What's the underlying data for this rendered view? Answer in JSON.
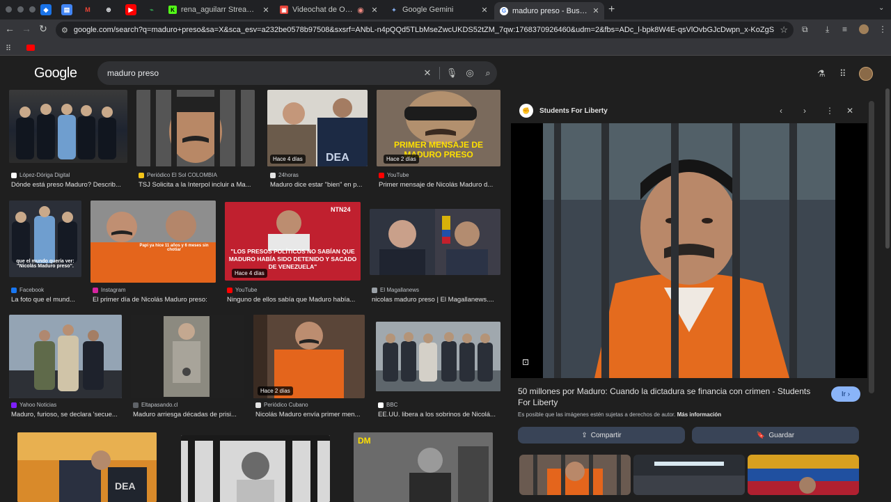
{
  "browser": {
    "pinned_tabs": [
      "drive-icon",
      "docs-icon",
      "gmail-icon",
      "chatgpt-icon",
      "youtube-icon",
      "meet-icon"
    ],
    "tabs": [
      {
        "title": "rena_aguilarr Stream - Watch",
        "favicon": "kick-icon",
        "favcolor": "#53fc18",
        "favchar": "K"
      },
      {
        "title": "Videochat de OmeTV: una",
        "favicon": "ometv-icon",
        "favcolor": "#e8443a",
        "favchar": "▣"
      },
      {
        "title": "Google Gemini",
        "favicon": "gemini-icon",
        "favcolor": "#4f86f7",
        "favchar": "✦"
      },
      {
        "title": "maduro preso - Buscar con G",
        "favicon": "google-icon",
        "favcolor": "#ffffff",
        "favchar": "G"
      }
    ],
    "url": "google.com/search?q=maduro+preso&sa=X&sca_esv=a232be0578b97508&sxsrf=ANbL-n4pQQd5TLbMseZwcUKDS52tZM_7qw:1768370926460&udm=2&fbs=ADc_l-bpk8W4E-qsVlOvbGJcDwpn_x-KoZgS_dIzvUJcCpPvNisF..."
  },
  "search": {
    "logo": "Google",
    "query": "maduro preso"
  },
  "results": [
    {
      "source": "López-Dóriga Digital",
      "title": "Dónde está preso Maduro? Describ...",
      "badge": "",
      "overlay": ""
    },
    {
      "source": "Periódico El Sol COLOMBIA",
      "title": "TSJ Solicita a la Interpol incluir a Ma...",
      "badge": "",
      "overlay": ""
    },
    {
      "source": "24horas",
      "title": "Maduro dice estar \"bien\" en p...",
      "badge": "Hace 4 días",
      "overlay": ""
    },
    {
      "source": "YouTube",
      "title": "Primer mensaje de Nicolás Maduro d...",
      "badge": "Hace 2 días",
      "overlay": "PRIMER MENSAJE DE MADURO PRESO"
    },
    {
      "source": "Facebook",
      "title": "La foto que el mund...",
      "badge": "",
      "overlay": "que el mundo quería ver: \"Nicolás Maduro preso\"."
    },
    {
      "source": "Instagram",
      "title": "El primer día de Nicolás Maduro preso:",
      "badge": "",
      "overlay": "Papi ya hice 11 años y 6 meses sin chotiar"
    },
    {
      "source": "YouTube",
      "title": "Ninguno de ellos sabía que Maduro había...",
      "badge": "Hace 4 días",
      "overlay": "\"LOS PRESOS POLÍTICOS NO SABÍAN QUE MADURO HABÍA SIDO DETENIDO Y SACADO DE VENEZUELA\""
    },
    {
      "source": "El Magallanews",
      "title": "nicolas maduro preso | El Magallanews....",
      "badge": "",
      "overlay": ""
    },
    {
      "source": "Yahoo Noticias",
      "title": "Maduro, furioso, se declara 'secue...",
      "badge": "",
      "overlay": ""
    },
    {
      "source": "Eltapasando.cl",
      "title": "Maduro arriesga décadas de prisi...",
      "badge": "",
      "overlay": ""
    },
    {
      "source": "Periódico Cubano",
      "title": "Nicolás Maduro envía primer men...",
      "badge": "Hace 2 días",
      "overlay": ""
    },
    {
      "source": "BBC",
      "title": "EE.UU. libera a los sobrinos de Nicolá...",
      "badge": "",
      "overlay": ""
    }
  ],
  "row4_labels": {
    "dea": "DEA",
    "channel": "NTN24",
    "dm": "DM"
  },
  "panel": {
    "site": "Students For Liberty",
    "title": "50 millones por Maduro: Cuando la dictadura se financia con crimen - Students For Liberty",
    "visit_label": "Ir",
    "copyright_note": "Es posible que las imágenes estén sujetas a derechos de autor.",
    "more_info": "Más información",
    "share_label": "Compartir",
    "save_label": "Guardar"
  }
}
